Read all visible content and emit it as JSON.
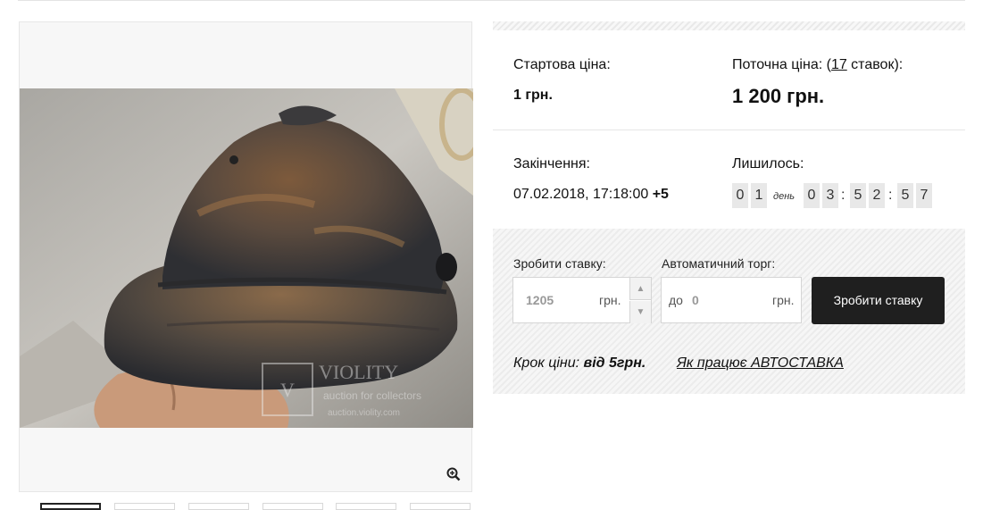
{
  "lot": {
    "start_price_label": "Стартова ціна:",
    "start_price_value": "1 грн.",
    "current_price_prefix": "Поточна ціна: (",
    "bids_count": "17",
    "bids_suffix": " ставок):",
    "current_price_value": "1 200 грн.",
    "ending_label": "Закінчення:",
    "ending_value": "07.02.2018, 17:18:00",
    "ending_tz": "+5",
    "remaining_label": "Лишилось:",
    "countdown": {
      "days": [
        "0",
        "1"
      ],
      "day_word": "день",
      "hours": [
        "0",
        "3"
      ],
      "minutes": [
        "5",
        "2"
      ],
      "seconds": [
        "5",
        "7"
      ],
      "separator": ":"
    }
  },
  "bid_form": {
    "bid_label": "Зробити ставку:",
    "bid_value": "1205",
    "bid_unit": "грн.",
    "auto_label": "Автоматичний торг:",
    "auto_prefix": "до",
    "auto_value": "0",
    "auto_unit": "грн.",
    "submit_label": "Зробити ставку",
    "step_label": "Крок ціни:",
    "step_value": "від 5грн.",
    "auto_help_link": "Як працює АВТОСТАВКА"
  },
  "gallery": {
    "watermark_brand": "VIOLITY",
    "watermark_sub": "auction for collectors",
    "watermark_url": "auction.violity.com",
    "zoom_icon": "zoom-in-icon",
    "thumb_count": 6
  }
}
